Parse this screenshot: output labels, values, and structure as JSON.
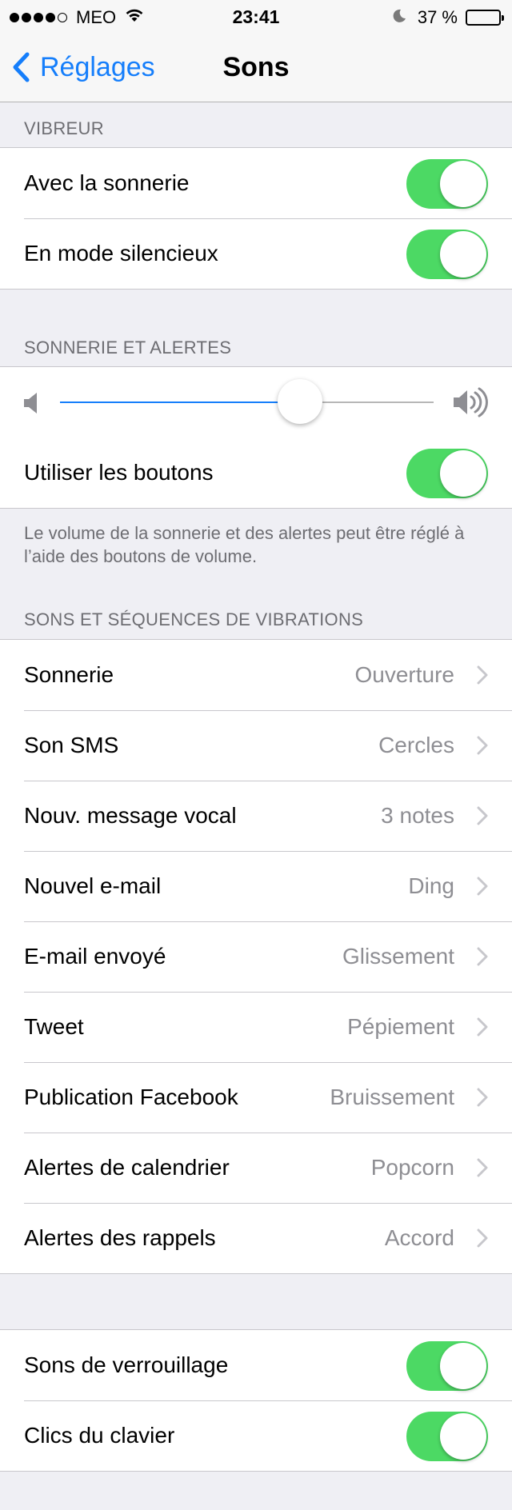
{
  "status_bar": {
    "carrier": "MEO",
    "time": "23:41",
    "battery_text": "37 %",
    "battery_level": 0.37,
    "signal_bars": 4,
    "signal_max": 5
  },
  "nav": {
    "back_label": "Réglages",
    "title": "Sons"
  },
  "vibreur": {
    "header": "VIBREUR",
    "rows": [
      {
        "label": "Avec la sonnerie",
        "on": true
      },
      {
        "label": "En mode silencieux",
        "on": true
      }
    ]
  },
  "sonnerie": {
    "header": "SONNERIE ET ALERTES",
    "volume_level": 0.643,
    "use_buttons_label": "Utiliser les boutons",
    "use_buttons_on": true,
    "footer": "Le volume de la sonnerie et des alertes peut être réglé à l’aide des boutons de volume."
  },
  "sons": {
    "header": "SONS ET SÉQUENCES DE VIBRATIONS",
    "rows": [
      {
        "label": "Sonnerie",
        "value": "Ouverture"
      },
      {
        "label": "Son SMS",
        "value": "Cercles"
      },
      {
        "label": "Nouv. message vocal",
        "value": "3 notes"
      },
      {
        "label": "Nouvel e-mail",
        "value": "Ding"
      },
      {
        "label": "E-mail envoyé",
        "value": "Glissement"
      },
      {
        "label": "Tweet",
        "value": "Pépiement"
      },
      {
        "label": "Publication Facebook",
        "value": "Bruissement"
      },
      {
        "label": "Alertes de calendrier",
        "value": "Popcorn"
      },
      {
        "label": "Alertes des rappels",
        "value": "Accord"
      }
    ]
  },
  "autres": {
    "rows": [
      {
        "label": "Sons de verrouillage",
        "on": true
      },
      {
        "label": "Clics du clavier",
        "on": true
      }
    ]
  },
  "colors": {
    "accent": "#157efb",
    "toggle_on": "#4cd964",
    "background": "#efeff4"
  }
}
